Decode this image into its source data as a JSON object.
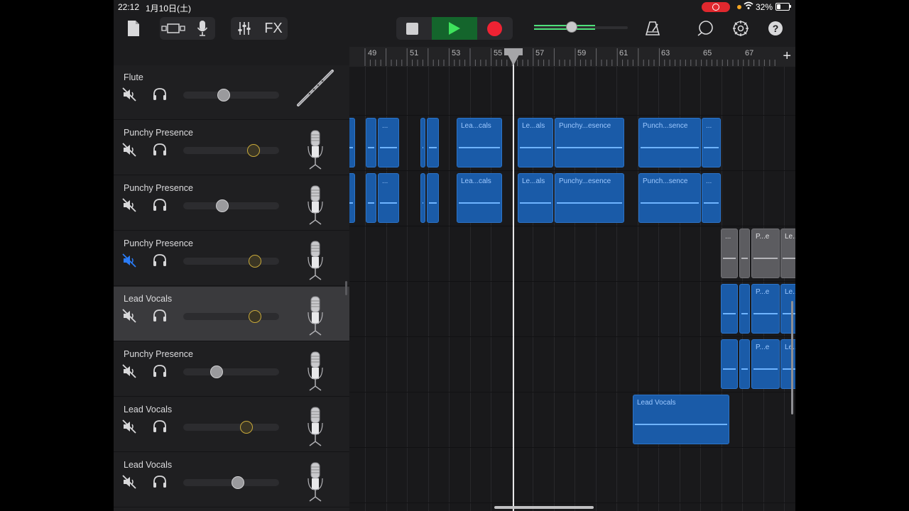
{
  "status_bar": {
    "time": "22:12",
    "date": "1月10日(土)",
    "battery": "32%"
  },
  "toolbar": {
    "fx_label": "FX",
    "help_label": "?"
  },
  "ruler": {
    "bars": [
      "49",
      "51",
      "53",
      "55",
      "57",
      "59",
      "61",
      "63",
      "65",
      "67"
    ],
    "add_label": "+"
  },
  "tracks": [
    {
      "name": "Flute",
      "muted": false,
      "volume": 0.42,
      "instrument": "flute-icon"
    },
    {
      "name": "Punchy Presence",
      "muted": false,
      "volume": 0.73,
      "instrument": "microphone-icon"
    },
    {
      "name": "Punchy Presence",
      "muted": false,
      "volume": 0.41,
      "instrument": "microphone-icon"
    },
    {
      "name": "Punchy Presence",
      "muted": true,
      "volume": 0.75,
      "instrument": "microphone-icon"
    },
    {
      "name": "Lead Vocals",
      "muted": false,
      "volume": 0.75,
      "instrument": "microphone-icon",
      "selected": true
    },
    {
      "name": "Punchy Presence",
      "muted": false,
      "volume": 0.35,
      "instrument": "microphone-icon"
    },
    {
      "name": "Lead Vocals",
      "muted": false,
      "volume": 0.66,
      "instrument": "microphone-icon"
    },
    {
      "name": "Lead Vocals",
      "muted": false,
      "volume": 0.57,
      "instrument": "microphone-icon"
    }
  ],
  "regions": {
    "r1a": "...",
    "r1b": "Lea...cals",
    "r1c": "Le...als",
    "r1d": "Punchy...esence",
    "r1e": "Punch...sence",
    "r1f": "...",
    "r2a": "...",
    "r2b": "Lea...cals",
    "r2c": "Le...als",
    "r2d": "Punchy...esence",
    "r2e": "Punch...sence",
    "r2f": "...",
    "r3a": "...",
    "r3b": "P...e",
    "r3c": "Le...",
    "r4b": "P...e",
    "r4c": "Le...",
    "r5b": "P...e",
    "r5c": "Le...",
    "r6": "Lead Vocals"
  },
  "colors": {
    "region_blue": "#1a5ba8",
    "region_gray": "#5c5c60",
    "play_green": "#3ee35c",
    "record_red": "#ef2233",
    "mute_active_blue": "#2a7bf6"
  }
}
